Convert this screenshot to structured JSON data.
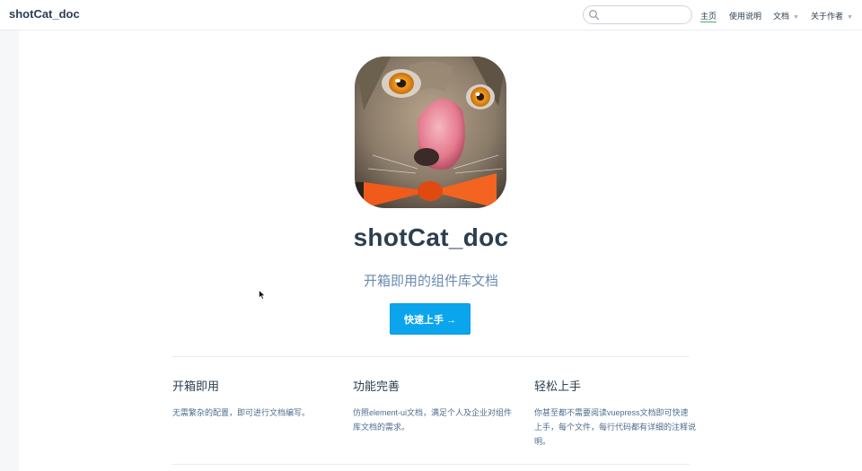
{
  "navbar": {
    "site_name": "shotCat_doc",
    "search": {
      "value": "",
      "placeholder": ""
    },
    "links": [
      {
        "label": "主页",
        "active": true,
        "dropdown": false
      },
      {
        "label": "使用说明",
        "active": false,
        "dropdown": false
      },
      {
        "label": "文档",
        "active": false,
        "dropdown": true
      },
      {
        "label": "关于作者",
        "active": false,
        "dropdown": true
      }
    ]
  },
  "hero": {
    "image_icon": "cat-avatar-image",
    "title": "shotCat_doc",
    "description": "开箱即用的组件库文档",
    "action_label": "快速上手 →"
  },
  "features": [
    {
      "title": "开箱即用",
      "details": "无需繁杂的配置，即可进行文档编写。"
    },
    {
      "title": "功能完善",
      "details": "仿照element-ui文档，满足个人及企业对组件库文档的需求。"
    },
    {
      "title": "轻松上手",
      "details": "你甚至都不需要阅读vuepress文档即可快速上手，每个文件，每行代码都有详细的注释说明。"
    }
  ],
  "colors": {
    "accent": "#3eaf7c",
    "button": "#0ba5ee",
    "text": "#2c3e50",
    "muted": "#6a8bad"
  }
}
